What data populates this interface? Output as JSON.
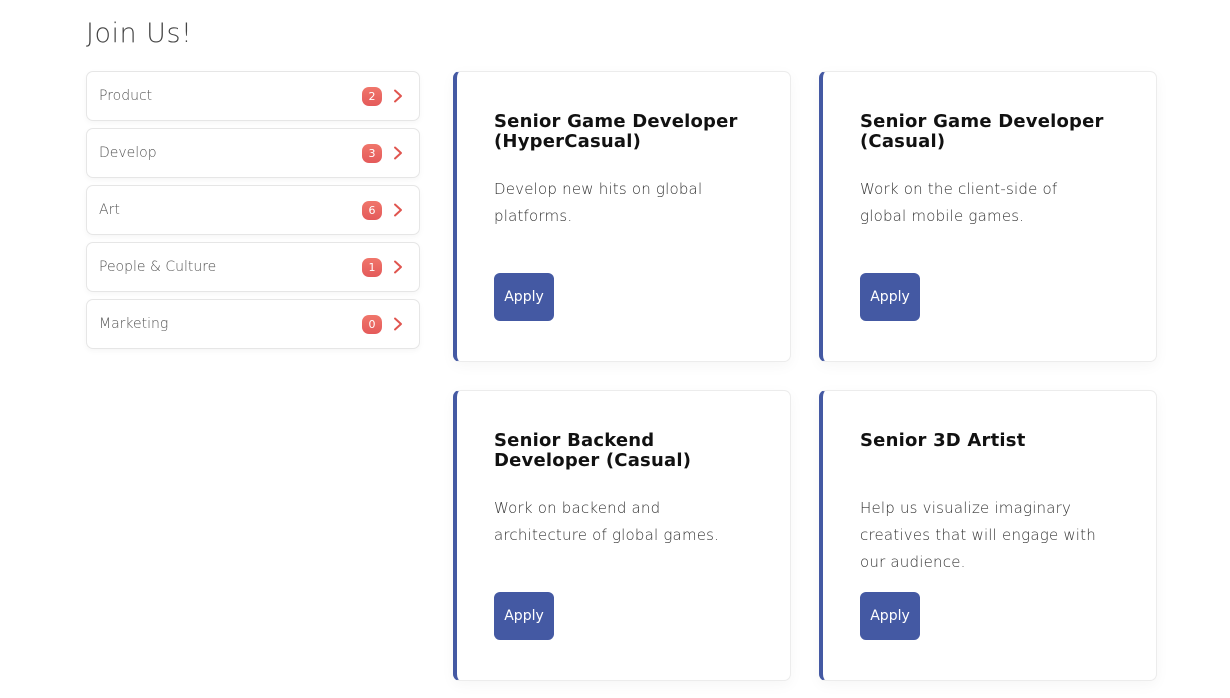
{
  "page": {
    "title": "Join  Us!"
  },
  "categories": [
    {
      "label": "Product",
      "count": "2"
    },
    {
      "label": "Develop",
      "count": "3"
    },
    {
      "label": "Art",
      "count": "6"
    },
    {
      "label": "People & Culture",
      "count": "1"
    },
    {
      "label": "Marketing",
      "count": "0"
    }
  ],
  "jobs": [
    {
      "title": "Senior Game Developer (HyperCasual)",
      "description": "Develop new hits on global platforms.",
      "apply_label": "Apply"
    },
    {
      "title": "Senior Game Developer (Casual)",
      "description": "Work on the client-side of global mobile games.",
      "apply_label": "Apply"
    },
    {
      "title": "Senior Backend Developer (Casual)",
      "description": "Work on backend and architecture of global games.",
      "apply_label": "Apply"
    },
    {
      "title": "Senior 3D Artist",
      "description": "Help us visualize imaginary creatives that will engage with our audience.",
      "apply_label": "Apply"
    }
  ],
  "icons": {
    "category_chevron": "chevron-right-icon"
  },
  "colors": {
    "accent": "#4459a3",
    "badge": "#e45a5a",
    "chevron": "#e0554f"
  }
}
